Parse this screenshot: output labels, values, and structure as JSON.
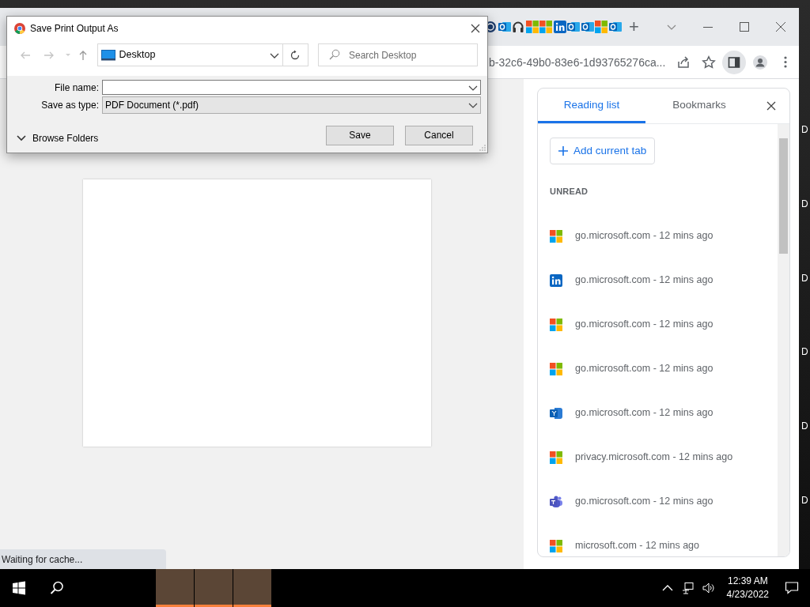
{
  "browser": {
    "tabs": [
      {
        "kind": "circle"
      },
      {
        "kind": "outlook"
      },
      {
        "kind": "headset"
      },
      {
        "kind": "microsoft"
      },
      {
        "kind": "microsoft"
      },
      {
        "kind": "linkedin"
      },
      {
        "kind": "outlook"
      },
      {
        "kind": "outlook"
      },
      {
        "kind": "microsoft"
      },
      {
        "kind": "outlook"
      }
    ],
    "new_tab": "+",
    "address": "b-32c6-49b0-83e6-1d93765276ca...",
    "side_panel_button": {
      "on": true
    }
  },
  "dialog": {
    "title": "Save Print Output As",
    "location": "Desktop",
    "search": {
      "placeholder": "Search Desktop"
    },
    "file_name_label": "File name:",
    "save_as_type": {
      "label": "Save as type:",
      "value": "PDF Document (*.pdf)"
    },
    "browse_folders": "Browse Folders",
    "buttons": [
      "Save",
      "Cancel"
    ]
  },
  "preview_status": "Waiting for cache...",
  "side_panel": {
    "tabs": [
      {
        "label": "Reading list",
        "selected": true
      },
      {
        "label": "Bookmarks",
        "selected": false
      }
    ],
    "add_button": "Add current tab",
    "section": "UNREAD",
    "items": [
      {
        "kind": "microsoft",
        "text": "go.microsoft.com - 12 mins ago"
      },
      {
        "kind": "linkedin",
        "text": "go.microsoft.com - 12 mins ago"
      },
      {
        "kind": "microsoft",
        "text": "go.microsoft.com - 12 mins ago"
      },
      {
        "kind": "microsoft",
        "text": "go.microsoft.com - 12 mins ago"
      },
      {
        "kind": "yammer",
        "text": "go.microsoft.com - 12 mins ago"
      },
      {
        "kind": "microsoft",
        "text": "privacy.microsoft.com - 12 mins ago"
      },
      {
        "kind": "teams",
        "text": "go.microsoft.com - 12 mins ago"
      },
      {
        "kind": "microsoft",
        "text": "microsoft.com - 12 mins ago"
      }
    ]
  },
  "desktop_labels": [
    "D",
    "D",
    "D",
    "D",
    "D",
    "D"
  ],
  "taskbar": {
    "apps": [
      {
        "flashing": true
      },
      {
        "flashing": true
      },
      {
        "flashing": true
      }
    ],
    "time": "12:39 AM",
    "date": "4/23/2022"
  }
}
